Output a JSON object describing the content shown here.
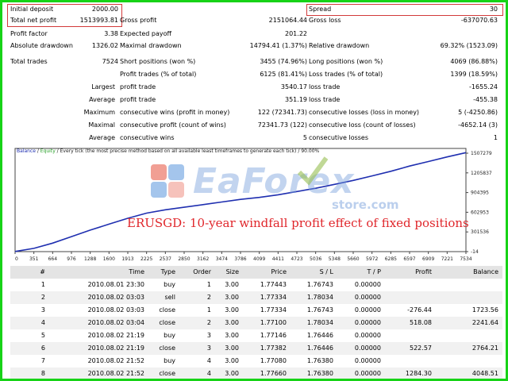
{
  "summary": {
    "initial_deposit_label": "Initial deposit",
    "initial_deposit_value": "2000.00",
    "total_net_profit_label": "Total net profit",
    "total_net_profit_value": "1513993.81",
    "gross_profit_label": "Gross profit",
    "gross_profit_value": "2151064.44",
    "gross_loss_label": "Gross loss",
    "gross_loss_value": "-637070.63",
    "spread_label": "Spread",
    "spread_value": "30",
    "profit_factor_label": "Profit factor",
    "profit_factor_value": "3.38",
    "expected_payoff_label": "Expected payoff",
    "expected_payoff_value": "201.22",
    "absolute_drawdown_label": "Absolute drawdown",
    "absolute_drawdown_value": "1326.02",
    "maximal_drawdown_label": "Maximal drawdown",
    "maximal_drawdown_value": "14794.41 (1.37%)",
    "relative_drawdown_label": "Relative drawdown",
    "relative_drawdown_value": "69.32% (1523.09)",
    "total_trades_label": "Total trades",
    "total_trades_value": "7524",
    "short_positions_label": "Short positions (won %)",
    "short_positions_value": "3455 (74.96%)",
    "long_positions_label": "Long positions (won %)",
    "long_positions_value": "4069 (86.88%)",
    "profit_trades_label": "Profit trades (% of total)",
    "profit_trades_value": "6125 (81.41%)",
    "loss_trades_label": "Loss trades (% of total)",
    "loss_trades_value": "1399 (18.59%)",
    "largest_label": "Largest",
    "largest_profit_label": "profit trade",
    "largest_profit_value": "3540.17",
    "largest_loss_label": "loss trade",
    "largest_loss_value": "-1655.24",
    "average_label": "Average",
    "average_profit_label": "profit trade",
    "average_profit_value": "351.19",
    "average_loss_label": "loss trade",
    "average_loss_value": "-455.38",
    "maximum_label": "Maximum",
    "max_cons_wins_label": "consecutive wins (profit in money)",
    "max_cons_wins_value": "122 (72341.73)",
    "max_cons_losses_label": "consecutive losses (loss in money)",
    "max_cons_losses_value": "5 (-4250.86)",
    "maximal_label": "Maximal",
    "maximal_cons_profit_label": "consecutive profit (count of wins)",
    "maximal_cons_profit_value": "72341.73 (122)",
    "maximal_cons_loss_label": "consecutive loss (count of losses)",
    "maximal_cons_loss_value": "-4652.14 (3)",
    "avg_cons_label": "Average",
    "avg_cons_wins_label": "consecutive wins",
    "avg_cons_wins_value": "5",
    "avg_cons_losses_label": "consecutive losses",
    "avg_cons_losses_value": "1"
  },
  "chart": {
    "header_balance": "Balance",
    "header_sep": " / ",
    "header_equity": "Equity",
    "header_rest": " / Every tick (the most precise method based on all available least timeframes to generate each tick) / 90.00%"
  },
  "chart_data": {
    "type": "line",
    "series": [
      {
        "name": "Balance",
        "values": [
          2000,
          50000,
          130000,
          230000,
          330000,
          420000,
          510000,
          590000,
          640000,
          680000,
          720000,
          760000,
          800000,
          830000,
          870000,
          920000,
          970000,
          1030000,
          1090000,
          1160000,
          1230000,
          1310000,
          1380000,
          1450000,
          1515994
        ]
      }
    ],
    "x_ticks": [
      "0",
      "351",
      "664",
      "976",
      "1288",
      "1600",
      "1913",
      "2225",
      "2537",
      "2850",
      "3162",
      "3474",
      "3786",
      "4099",
      "4411",
      "4723",
      "5036",
      "5348",
      "5660",
      "5972",
      "6285",
      "6597",
      "6909",
      "7221",
      "7534"
    ],
    "y_ticks": [
      "1507279",
      "1205837",
      "904395",
      "602953",
      "301536",
      "-14"
    ],
    "ylim": [
      -14,
      1507279
    ],
    "xlim": [
      0,
      7534
    ],
    "line_color": "#1f2fb0",
    "grid": false
  },
  "watermark": {
    "brand": "EaForex",
    "sub": "store.com"
  },
  "overlay_title": "ERUSGD: 10-year windfall profit effect of fixed positions",
  "table": {
    "headers": [
      "#",
      "Time",
      "Type",
      "Order",
      "Size",
      "Price",
      "S / L",
      "T / P",
      "Profit",
      "Balance"
    ],
    "rows": [
      [
        "1",
        "2010.08.01 23:30",
        "buy",
        "1",
        "3.00",
        "1.77443",
        "1.76743",
        "0.00000",
        "",
        ""
      ],
      [
        "2",
        "2010.08.02 03:03",
        "sell",
        "2",
        "3.00",
        "1.77334",
        "1.78034",
        "0.00000",
        "",
        ""
      ],
      [
        "3",
        "2010.08.02 03:03",
        "close",
        "1",
        "3.00",
        "1.77334",
        "1.76743",
        "0.00000",
        "-276.44",
        "1723.56"
      ],
      [
        "4",
        "2010.08.02 03:04",
        "close",
        "2",
        "3.00",
        "1.77100",
        "1.78034",
        "0.00000",
        "518.08",
        "2241.64"
      ],
      [
        "5",
        "2010.08.02 21:19",
        "buy",
        "3",
        "3.00",
        "1.77146",
        "1.76446",
        "0.00000",
        "",
        ""
      ],
      [
        "6",
        "2010.08.02 21:19",
        "close",
        "3",
        "3.00",
        "1.77382",
        "1.76446",
        "0.00000",
        "522.57",
        "2764.21"
      ],
      [
        "7",
        "2010.08.02 21:52",
        "buy",
        "4",
        "3.00",
        "1.77080",
        "1.76380",
        "0.00000",
        "",
        ""
      ],
      [
        "8",
        "2010.08.02 21:52",
        "close",
        "4",
        "3.00",
        "1.77660",
        "1.76380",
        "0.00000",
        "1284.30",
        "4048.51"
      ]
    ]
  }
}
